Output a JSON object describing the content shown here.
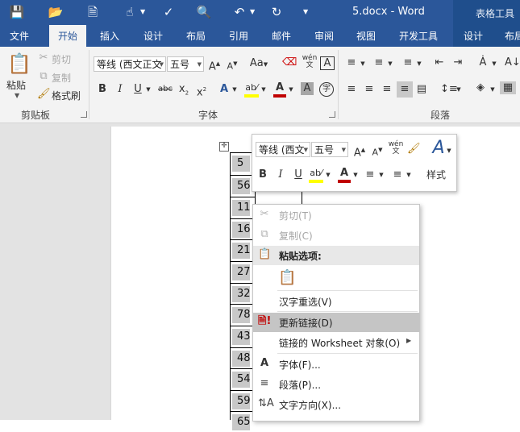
{
  "titlebar": {
    "document_title": "5.docx - Word",
    "contextual_label": "表格工具",
    "quick_access": [
      "save-icon",
      "open-folder-icon",
      "new-document-icon",
      "touch-mode-icon",
      "spelling-icon",
      "print-preview-icon",
      "undo-icon",
      "redo-icon"
    ]
  },
  "tabs": [
    "文件",
    "开始",
    "插入",
    "设计",
    "布局",
    "引用",
    "邮件",
    "审阅",
    "视图",
    "开发工具",
    "设计",
    "布局"
  ],
  "active_tab": "开始",
  "ribbon": {
    "clipboard": {
      "paste": "粘贴",
      "cut": "剪切",
      "copy": "复制",
      "format_painter": "格式刷",
      "group_label": "剪贴板"
    },
    "font": {
      "font_name": "等线 (西文正文",
      "font_size": "五号",
      "group_label": "字体",
      "phonetic_glyph": "wén",
      "phonetic_sub": "文",
      "boxed_char": "A",
      "circled_char": "字",
      "change_case": "Aa",
      "highlight_color": "#ffff00",
      "font_color": "#c00000"
    },
    "paragraph": {
      "group_label": "段落"
    }
  },
  "document": {
    "table_cells": [
      "5",
      "56",
      "11",
      "16",
      "21",
      "27",
      "32",
      "78",
      "43",
      "48",
      "54",
      "59",
      "65"
    ]
  },
  "mini_toolbar": {
    "font_name": "等线 (西文",
    "font_size": "五号",
    "styles": "样式",
    "phonetic_glyph": "wén",
    "phonetic_sub": "文"
  },
  "context_menu": {
    "items": [
      {
        "label": "剪切(T)",
        "icon": "scissors-icon",
        "enabled": false
      },
      {
        "label": "复制(C)",
        "icon": "copy-icon",
        "enabled": false
      },
      {
        "label": "粘贴选项:",
        "icon": "paste-icon",
        "enabled": true
      },
      {
        "label": "汉字重选(V)",
        "enabled": true
      },
      {
        "label": "更新链接(D)",
        "icon": "update-link-icon",
        "enabled": true,
        "highlighted": true
      },
      {
        "label": "链接的 Worksheet 对象(O)",
        "enabled": true,
        "submenu": true
      },
      {
        "label": "字体(F)...",
        "icon": "font-icon",
        "enabled": true
      },
      {
        "label": "段落(P)...",
        "icon": "paragraph-icon",
        "enabled": true
      },
      {
        "label": "文字方向(X)...",
        "icon": "text-direction-icon",
        "enabled": true
      }
    ]
  }
}
